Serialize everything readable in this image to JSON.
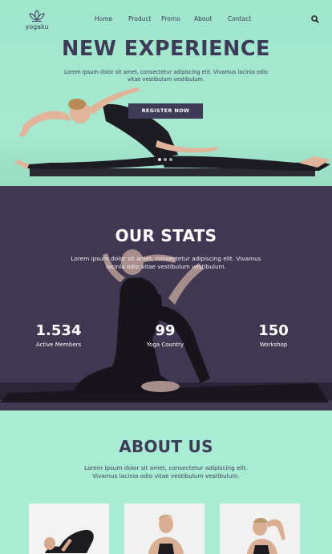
{
  "brand": {
    "name": "yogaku"
  },
  "nav": {
    "items": [
      {
        "label": "Home"
      },
      {
        "label": "Product"
      },
      {
        "label": "Promo"
      },
      {
        "label": "About"
      },
      {
        "label": "Contact"
      }
    ],
    "search_icon": "search-icon"
  },
  "hero": {
    "title": "NEW EXPERIENCE",
    "subtitle": "Lorem ipsum dolor sit amet, consectetur adipiscing elit. Vivamus lacinia odio vitae vestibulum vestibulum.",
    "cta_label": "REGISTER NOW",
    "carousel_slide_count": 3,
    "carousel_active_index": 0
  },
  "stats": {
    "title": "OUR STATS",
    "subtitle": "Lorem ipsum dolor sit amet, consectetur adipiscing elit. Vivamus lacinia odio vitae vestibulum vestibulum.",
    "items": [
      {
        "value": "1.534",
        "label": "Active Members"
      },
      {
        "value": "99",
        "label": "Yoga  Country"
      },
      {
        "value": "150",
        "label": "Workshop"
      }
    ]
  },
  "about": {
    "title": "ABOUT US",
    "subtitle": "Lorem ipsum dolor sit amet, consectetur adipiscing elit. Vivamus lacinia odio vitae vestibulum vestibulum."
  },
  "colors": {
    "mint": "#a6e8d0",
    "navy": "#3e3b58",
    "stats_bg": "#403853",
    "white": "#ffffff"
  }
}
